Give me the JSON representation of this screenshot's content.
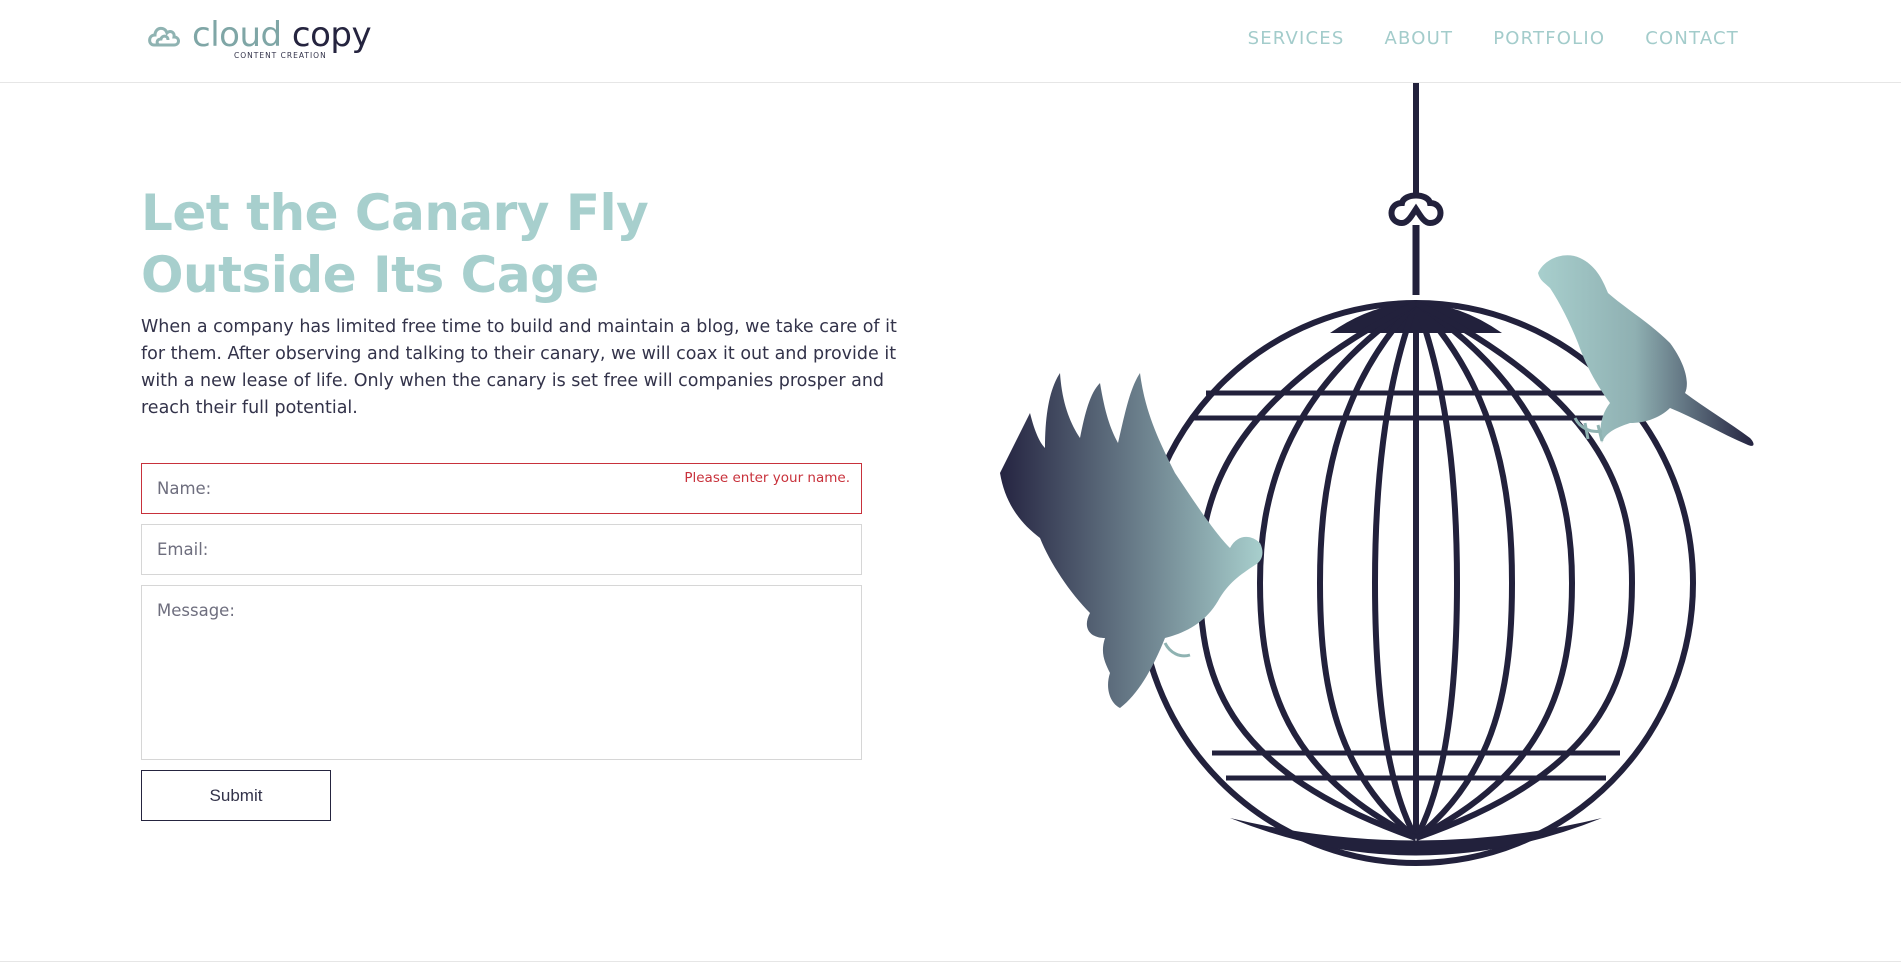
{
  "brand": {
    "name_part1": "cloud",
    "name_part2": "copy",
    "tagline": "CONTENT CREATION",
    "accent_color": "#a7cfcd",
    "dark_color": "#25243f"
  },
  "nav": {
    "items": [
      {
        "label": "SERVICES"
      },
      {
        "label": "ABOUT"
      },
      {
        "label": "PORTFOLIO"
      },
      {
        "label": "CONTACT"
      }
    ]
  },
  "hero": {
    "headline_line1": "Let the Canary Fly",
    "headline_line2": "Outside Its Cage",
    "body": "When a company has limited free time to build and maintain a blog, we take care of it for them. After observing and talking to their canary, we will coax it out and provide it with a new lease of life. Only when the canary is set free will companies prosper and reach their full potential."
  },
  "form": {
    "name_placeholder": "Name:",
    "name_error": "Please enter your name.",
    "email_placeholder": "Email:",
    "message_placeholder": "Message:",
    "submit_label": "Submit",
    "error_color": "#c8313b"
  },
  "illustration": {
    "icons": [
      "cloud-logo-icon",
      "birdcage-icon",
      "flying-bird-icon",
      "perched-bird-icon"
    ]
  }
}
